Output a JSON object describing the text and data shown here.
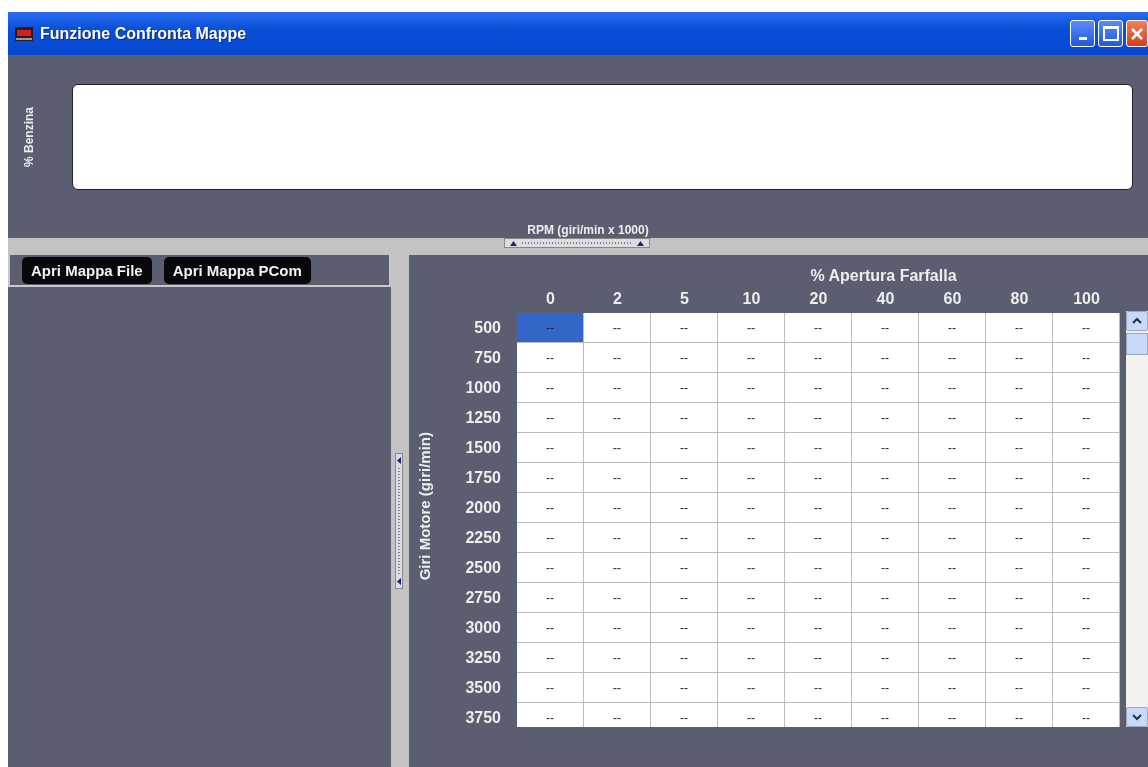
{
  "window": {
    "title": "Funzione Confronta Mappe"
  },
  "top_panel": {
    "axis_label": "% Benzina",
    "x_label": "RPM (giri/min x 1000)"
  },
  "buttons": [
    {
      "label": "Apri Mappa File"
    },
    {
      "label": "Apri Mappa PCom"
    }
  ],
  "table": {
    "title": "% Apertura Farfalla",
    "row_axis_label": "Giri Motore (giri/min)",
    "columns": [
      "0",
      "2",
      "5",
      "10",
      "20",
      "40",
      "60",
      "80",
      "100"
    ],
    "rows": [
      {
        "label": "500",
        "cells": [
          {
            "value": "--",
            "selected": true
          },
          {
            "value": "--",
            "selected": false
          },
          {
            "value": "--",
            "selected": false
          },
          {
            "value": "--",
            "selected": false
          },
          {
            "value": "--",
            "selected": false
          },
          {
            "value": "--",
            "selected": false
          },
          {
            "value": "--",
            "selected": false
          },
          {
            "value": "--",
            "selected": false
          },
          {
            "value": "--",
            "selected": false
          }
        ]
      },
      {
        "label": "750",
        "cells": [
          {
            "value": "--",
            "selected": false
          },
          {
            "value": "--",
            "selected": false
          },
          {
            "value": "--",
            "selected": false
          },
          {
            "value": "--",
            "selected": false
          },
          {
            "value": "--",
            "selected": false
          },
          {
            "value": "--",
            "selected": false
          },
          {
            "value": "--",
            "selected": false
          },
          {
            "value": "--",
            "selected": false
          },
          {
            "value": "--",
            "selected": false
          }
        ]
      },
      {
        "label": "1000",
        "cells": [
          {
            "value": "--",
            "selected": false
          },
          {
            "value": "--",
            "selected": false
          },
          {
            "value": "--",
            "selected": false
          },
          {
            "value": "--",
            "selected": false
          },
          {
            "value": "--",
            "selected": false
          },
          {
            "value": "--",
            "selected": false
          },
          {
            "value": "--",
            "selected": false
          },
          {
            "value": "--",
            "selected": false
          },
          {
            "value": "--",
            "selected": false
          }
        ]
      },
      {
        "label": "1250",
        "cells": [
          {
            "value": "--",
            "selected": false
          },
          {
            "value": "--",
            "selected": false
          },
          {
            "value": "--",
            "selected": false
          },
          {
            "value": "--",
            "selected": false
          },
          {
            "value": "--",
            "selected": false
          },
          {
            "value": "--",
            "selected": false
          },
          {
            "value": "--",
            "selected": false
          },
          {
            "value": "--",
            "selected": false
          },
          {
            "value": "--",
            "selected": false
          }
        ]
      },
      {
        "label": "1500",
        "cells": [
          {
            "value": "--",
            "selected": false
          },
          {
            "value": "--",
            "selected": false
          },
          {
            "value": "--",
            "selected": false
          },
          {
            "value": "--",
            "selected": false
          },
          {
            "value": "--",
            "selected": false
          },
          {
            "value": "--",
            "selected": false
          },
          {
            "value": "--",
            "selected": false
          },
          {
            "value": "--",
            "selected": false
          },
          {
            "value": "--",
            "selected": false
          }
        ]
      },
      {
        "label": "1750",
        "cells": [
          {
            "value": "--",
            "selected": false
          },
          {
            "value": "--",
            "selected": false
          },
          {
            "value": "--",
            "selected": false
          },
          {
            "value": "--",
            "selected": false
          },
          {
            "value": "--",
            "selected": false
          },
          {
            "value": "--",
            "selected": false
          },
          {
            "value": "--",
            "selected": false
          },
          {
            "value": "--",
            "selected": false
          },
          {
            "value": "--",
            "selected": false
          }
        ]
      },
      {
        "label": "2000",
        "cells": [
          {
            "value": "--",
            "selected": false
          },
          {
            "value": "--",
            "selected": false
          },
          {
            "value": "--",
            "selected": false
          },
          {
            "value": "--",
            "selected": false
          },
          {
            "value": "--",
            "selected": false
          },
          {
            "value": "--",
            "selected": false
          },
          {
            "value": "--",
            "selected": false
          },
          {
            "value": "--",
            "selected": false
          },
          {
            "value": "--",
            "selected": false
          }
        ]
      },
      {
        "label": "2250",
        "cells": [
          {
            "value": "--",
            "selected": false
          },
          {
            "value": "--",
            "selected": false
          },
          {
            "value": "--",
            "selected": false
          },
          {
            "value": "--",
            "selected": false
          },
          {
            "value": "--",
            "selected": false
          },
          {
            "value": "--",
            "selected": false
          },
          {
            "value": "--",
            "selected": false
          },
          {
            "value": "--",
            "selected": false
          },
          {
            "value": "--",
            "selected": false
          }
        ]
      },
      {
        "label": "2500",
        "cells": [
          {
            "value": "--",
            "selected": false
          },
          {
            "value": "--",
            "selected": false
          },
          {
            "value": "--",
            "selected": false
          },
          {
            "value": "--",
            "selected": false
          },
          {
            "value": "--",
            "selected": false
          },
          {
            "value": "--",
            "selected": false
          },
          {
            "value": "--",
            "selected": false
          },
          {
            "value": "--",
            "selected": false
          },
          {
            "value": "--",
            "selected": false
          }
        ]
      },
      {
        "label": "2750",
        "cells": [
          {
            "value": "--",
            "selected": false
          },
          {
            "value": "--",
            "selected": false
          },
          {
            "value": "--",
            "selected": false
          },
          {
            "value": "--",
            "selected": false
          },
          {
            "value": "--",
            "selected": false
          },
          {
            "value": "--",
            "selected": false
          },
          {
            "value": "--",
            "selected": false
          },
          {
            "value": "--",
            "selected": false
          },
          {
            "value": "--",
            "selected": false
          }
        ]
      },
      {
        "label": "3000",
        "cells": [
          {
            "value": "--",
            "selected": false
          },
          {
            "value": "--",
            "selected": false
          },
          {
            "value": "--",
            "selected": false
          },
          {
            "value": "--",
            "selected": false
          },
          {
            "value": "--",
            "selected": false
          },
          {
            "value": "--",
            "selected": false
          },
          {
            "value": "--",
            "selected": false
          },
          {
            "value": "--",
            "selected": false
          },
          {
            "value": "--",
            "selected": false
          }
        ]
      },
      {
        "label": "3250",
        "cells": [
          {
            "value": "--",
            "selected": false
          },
          {
            "value": "--",
            "selected": false
          },
          {
            "value": "--",
            "selected": false
          },
          {
            "value": "--",
            "selected": false
          },
          {
            "value": "--",
            "selected": false
          },
          {
            "value": "--",
            "selected": false
          },
          {
            "value": "--",
            "selected": false
          },
          {
            "value": "--",
            "selected": false
          },
          {
            "value": "--",
            "selected": false
          }
        ]
      },
      {
        "label": "3500",
        "cells": [
          {
            "value": "--",
            "selected": false
          },
          {
            "value": "--",
            "selected": false
          },
          {
            "value": "--",
            "selected": false
          },
          {
            "value": "--",
            "selected": false
          },
          {
            "value": "--",
            "selected": false
          },
          {
            "value": "--",
            "selected": false
          },
          {
            "value": "--",
            "selected": false
          },
          {
            "value": "--",
            "selected": false
          },
          {
            "value": "--",
            "selected": false
          }
        ]
      },
      {
        "label": "3750",
        "cells": [
          {
            "value": "--",
            "selected": false
          },
          {
            "value": "--",
            "selected": false
          },
          {
            "value": "--",
            "selected": false
          },
          {
            "value": "--",
            "selected": false
          },
          {
            "value": "--",
            "selected": false
          },
          {
            "value": "--",
            "selected": false
          },
          {
            "value": "--",
            "selected": false
          },
          {
            "value": "--",
            "selected": false
          },
          {
            "value": "--",
            "selected": false
          }
        ]
      }
    ]
  }
}
